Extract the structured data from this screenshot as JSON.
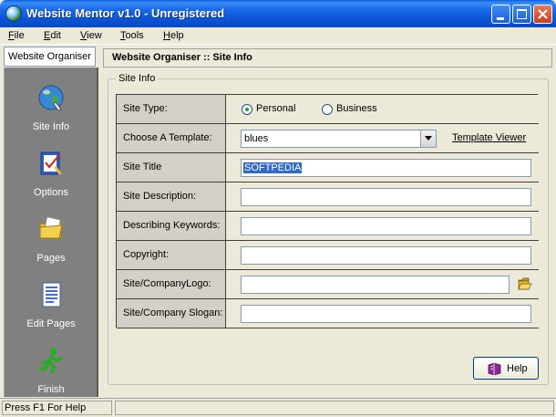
{
  "window": {
    "title": "Website Mentor v1.0 - Unregistered"
  },
  "menu": [
    {
      "label": "File",
      "underline": "F",
      "rest": "ile"
    },
    {
      "label": "Edit",
      "underline": "E",
      "rest": "dit"
    },
    {
      "label": "View",
      "underline": "V",
      "rest": "iew"
    },
    {
      "label": "Tools",
      "underline": "T",
      "rest": "ools"
    },
    {
      "label": "Help",
      "underline": "H",
      "rest": "elp"
    }
  ],
  "sidebar": {
    "tab_label": "Website Organiser",
    "items": [
      {
        "label": "Site Info",
        "icon": "globe-icon"
      },
      {
        "label": "Options",
        "icon": "checklist-icon"
      },
      {
        "label": "Pages",
        "icon": "folder-icon"
      },
      {
        "label": "Edit Pages",
        "icon": "document-icon"
      },
      {
        "label": "Finish",
        "icon": "running-man-icon"
      }
    ]
  },
  "header": {
    "title": "Website Organiser :: Site Info"
  },
  "group": {
    "title": "Site Info"
  },
  "form": {
    "site_type": {
      "label": "Site Type:",
      "options": [
        "Personal",
        "Business"
      ],
      "selected": "Personal"
    },
    "template": {
      "label": "Choose A Template:",
      "value": "blues",
      "viewer_label": "Template Viewer"
    },
    "site_title": {
      "label": "Site Title",
      "value": "SOFTPEDIA"
    },
    "site_description": {
      "label": "Site Description:",
      "value": ""
    },
    "keywords": {
      "label": "Describing Keywords:",
      "value": ""
    },
    "copyright": {
      "label": "Copyright:",
      "value": ""
    },
    "logo": {
      "label": "Site/CompanyLogo:",
      "value": ""
    },
    "slogan": {
      "label": "Site/Company Slogan:",
      "value": ""
    }
  },
  "help_button": {
    "label": "Help"
  },
  "status": {
    "text": "Press F1 For Help"
  }
}
